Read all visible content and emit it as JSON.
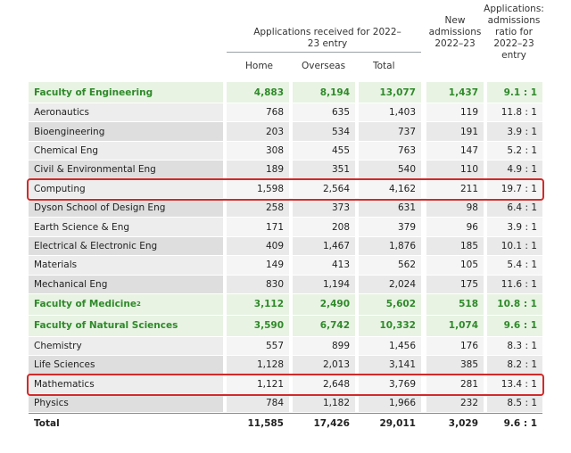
{
  "header": {
    "applications_group": "Applications received for 2022–23 entry",
    "new_admissions": "New admissions 2022–23",
    "ratio": "Applications: admissions ratio for 2022–23 entry",
    "home": "Home",
    "overseas": "Overseas",
    "total": "Total"
  },
  "rows": [
    {
      "label": "Faculty of Engineering",
      "home": "4,883",
      "overseas": "8,194",
      "total": "13,077",
      "admissions": "1,437",
      "ratio": "9.1 : 1",
      "type": "faculty"
    },
    {
      "label": "Aeronautics",
      "home": "768",
      "overseas": "635",
      "total": "1,403",
      "admissions": "119",
      "ratio": "11.8 : 1",
      "type": "normal"
    },
    {
      "label": "Bioengineering",
      "home": "203",
      "overseas": "534",
      "total": "737",
      "admissions": "191",
      "ratio": "3.9 : 1",
      "type": "alt"
    },
    {
      "label": "Chemical Eng",
      "home": "308",
      "overseas": "455",
      "total": "763",
      "admissions": "147",
      "ratio": "5.2 : 1",
      "type": "normal"
    },
    {
      "label": "Civil & Environmental Eng",
      "home": "189",
      "overseas": "351",
      "total": "540",
      "admissions": "110",
      "ratio": "4.9 : 1",
      "type": "alt"
    },
    {
      "label": "Computing",
      "home": "1,598",
      "overseas": "2,564",
      "total": "4,162",
      "admissions": "211",
      "ratio": "19.7 : 1",
      "type": "normal"
    },
    {
      "label": "Dyson School of Design Eng",
      "home": "258",
      "overseas": "373",
      "total": "631",
      "admissions": "98",
      "ratio": "6.4 : 1",
      "type": "alt"
    },
    {
      "label": "Earth Science & Eng",
      "home": "171",
      "overseas": "208",
      "total": "379",
      "admissions": "96",
      "ratio": "3.9 : 1",
      "type": "normal"
    },
    {
      "label": "Electrical & Electronic Eng",
      "home": "409",
      "overseas": "1,467",
      "total": "1,876",
      "admissions": "185",
      "ratio": "10.1 : 1",
      "type": "alt"
    },
    {
      "label": "Materials",
      "home": "149",
      "overseas": "413",
      "total": "562",
      "admissions": "105",
      "ratio": "5.4 : 1",
      "type": "normal"
    },
    {
      "label": "Mechanical Eng",
      "home": "830",
      "overseas": "1,194",
      "total": "2,024",
      "admissions": "175",
      "ratio": "11.6 : 1",
      "type": "alt"
    },
    {
      "label": "Faculty of Medicine",
      "sup": "2",
      "home": "3,112",
      "overseas": "2,490",
      "total": "5,602",
      "admissions": "518",
      "ratio": "10.8 : 1",
      "type": "faculty"
    },
    {
      "label": "Faculty of Natural Sciences",
      "home": "3,590",
      "overseas": "6,742",
      "total": "10,332",
      "admissions": "1,074",
      "ratio": "9.6 : 1",
      "type": "faculty"
    },
    {
      "label": "Chemistry",
      "home": "557",
      "overseas": "899",
      "total": "1,456",
      "admissions": "176",
      "ratio": "8.3 : 1",
      "type": "normal"
    },
    {
      "label": "Life Sciences",
      "home": "1,128",
      "overseas": "2,013",
      "total": "3,141",
      "admissions": "385",
      "ratio": "8.2 : 1",
      "type": "alt"
    },
    {
      "label": "Mathematics",
      "home": "1,121",
      "overseas": "2,648",
      "total": "3,769",
      "admissions": "281",
      "ratio": "13.4 : 1",
      "type": "normal"
    },
    {
      "label": "Physics",
      "home": "784",
      "overseas": "1,182",
      "total": "1,966",
      "admissions": "232",
      "ratio": "8.5 : 1",
      "type": "alt"
    },
    {
      "label": "Total",
      "home": "11,585",
      "overseas": "17,426",
      "total": "29,011",
      "admissions": "3,029",
      "ratio": "9.6 : 1",
      "type": "total"
    }
  ],
  "highlighted_rows": [
    "Computing",
    "Mathematics"
  ],
  "colors": {
    "faculty_text": "#2f8a2a",
    "faculty_bg": "#e8f3e3",
    "highlight_border": "#d22a2a"
  }
}
